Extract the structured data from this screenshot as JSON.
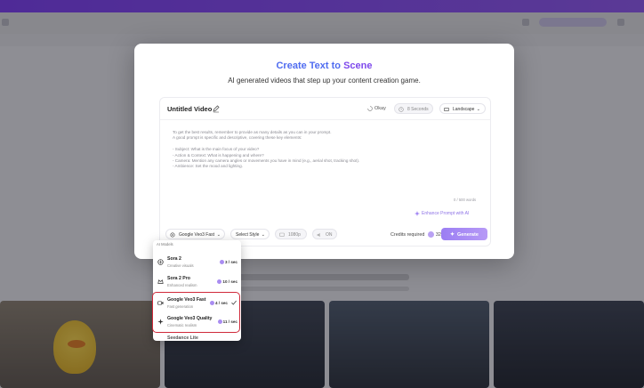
{
  "modal": {
    "title_part1": "Create Text to ",
    "title_part2": "Scene",
    "subtitle": "AI generated videos that step up your content creation game."
  },
  "editor": {
    "video_title": "Untitled Video",
    "status": "Okay",
    "duration": "8 Seconds",
    "orientation": "Landscape",
    "prompt_placeholder_lines": [
      "To get the best results, remember to provide as many details as you can in your prompt.",
      "A good prompt is specific and descriptive, covering these key elements:",
      "",
      "- Subject: What is the main focus of your video?",
      "- Action & Context: What is happening and where?",
      "- Camera: Mention any camera angles or movements you have in mind (e.g., aerial shot, tracking shot).",
      "- Ambience: Set the mood and lighting."
    ],
    "char_count": "0 / 500 words",
    "enhance_label": "Enhance Prompt with AI"
  },
  "footer": {
    "model_select": "Google Veo3 Fast",
    "style_select": "Select Style",
    "resolution": "1080p",
    "audio_toggle": "ON",
    "credits_label": "Credits required",
    "credits_value": "32",
    "generate_label": "Generate"
  },
  "dropdown": {
    "section_label": "AI Models",
    "items": [
      {
        "name": "Sora 2",
        "desc": "Creative visuals",
        "cost": "3 / sec",
        "selected": false
      },
      {
        "name": "Sora 2 Pro",
        "desc": "Enhanced realism",
        "cost": "10 / sec",
        "selected": false
      },
      {
        "name": "Google Veo3 Fast",
        "desc": "Fast generation",
        "cost": "4 / sec",
        "selected": true
      },
      {
        "name": "Google Veo3 Quality",
        "desc": "Cinematic realism",
        "cost": "11 / sec",
        "selected": false
      },
      {
        "name": "Seedance Lite",
        "desc": "",
        "cost": "",
        "selected": false
      }
    ]
  },
  "colors": {
    "accent": "#7e49ec",
    "title_blue": "#4f6cf0",
    "highlight_border": "#d02a3a"
  }
}
